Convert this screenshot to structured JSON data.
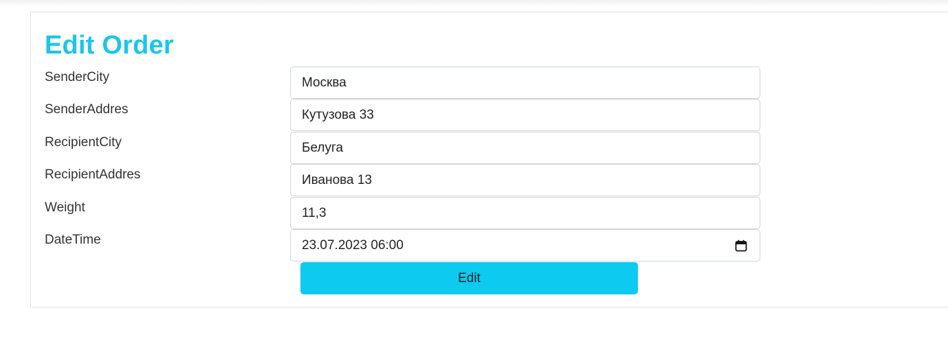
{
  "page": {
    "title": "Edit Order"
  },
  "form": {
    "fields": [
      {
        "label": "SenderCity",
        "value": "Москва"
      },
      {
        "label": "SenderAddres",
        "value": "Кутузова 33"
      },
      {
        "label": "RecipientCity",
        "value": "Белуга"
      },
      {
        "label": "RecipientAddres",
        "value": "Иванова 13"
      },
      {
        "label": "Weight",
        "value": "11,3"
      },
      {
        "label": "DateTime",
        "value": "23.07.2023 06:00"
      }
    ],
    "submit_label": "Edit"
  },
  "colors": {
    "title": "#1ec5e8",
    "button": "#0dcaf0"
  },
  "icons": {
    "datetime": "calendar-icon"
  }
}
